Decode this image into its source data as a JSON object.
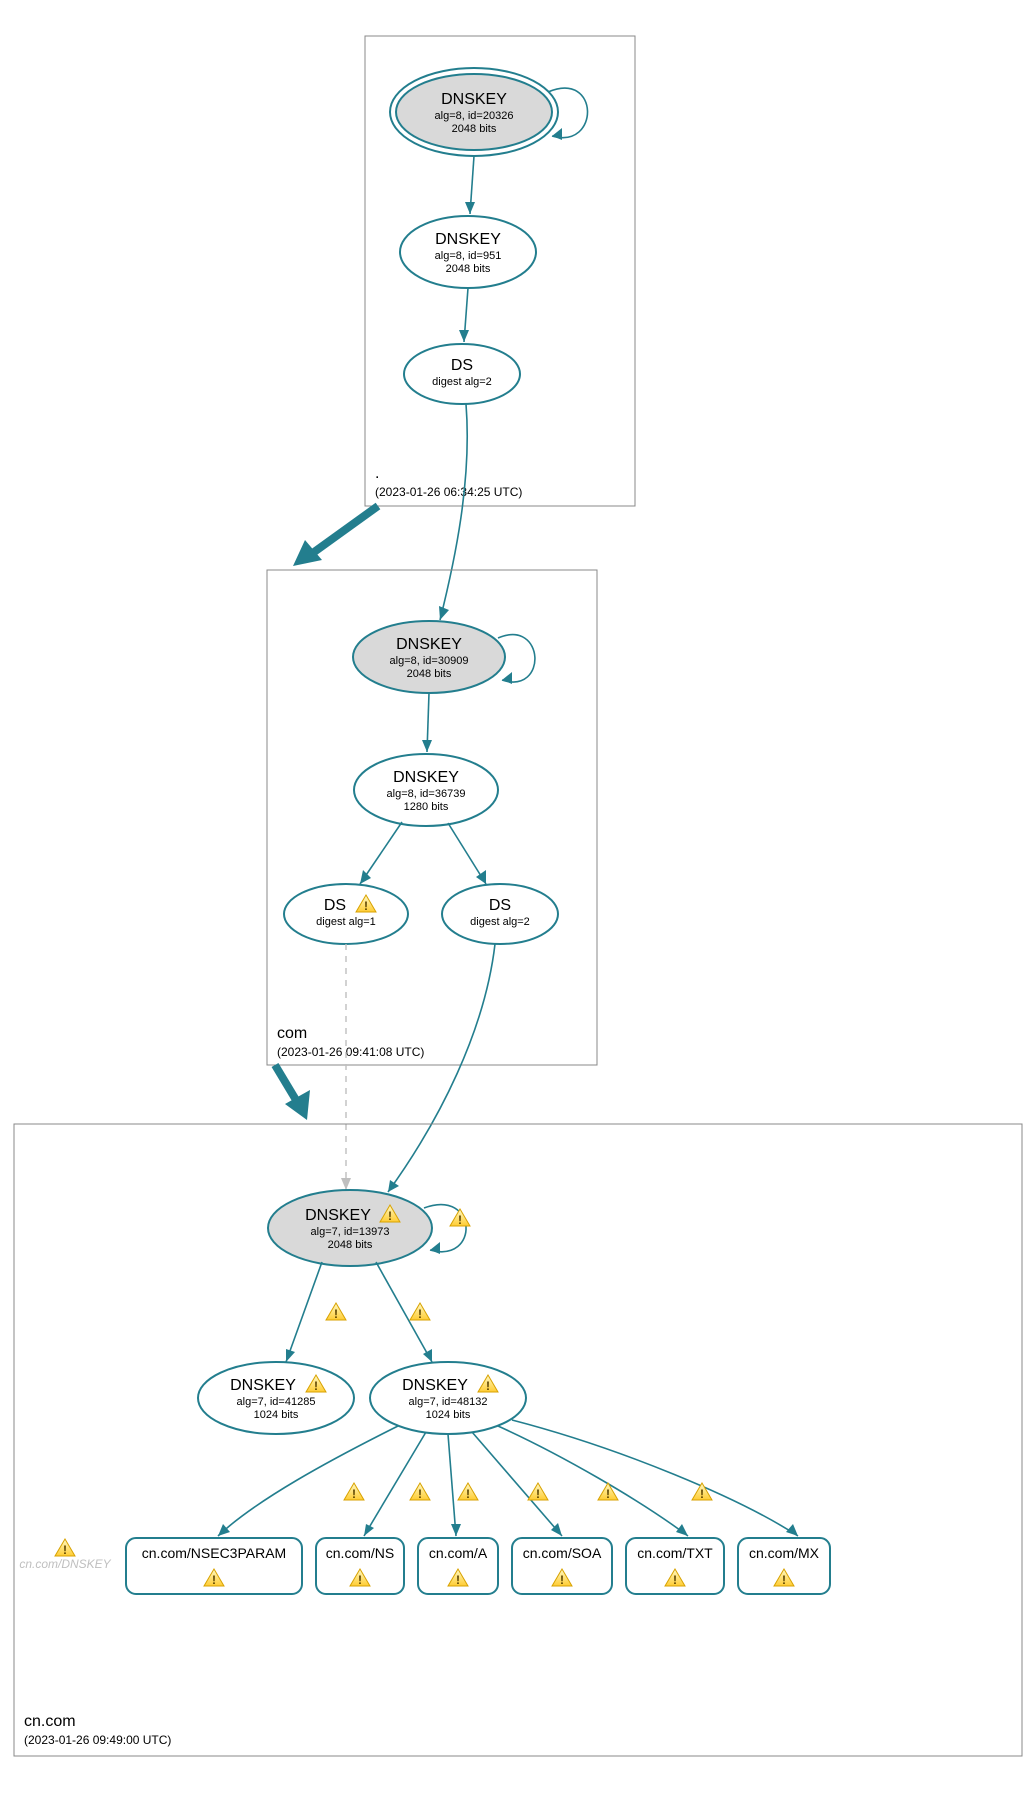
{
  "zones": {
    "root": {
      "name": ".",
      "timestamp": "(2023-01-26 06:34:25 UTC)",
      "nodes": {
        "ksk": {
          "title": "DNSKEY",
          "line1": "alg=8, id=20326",
          "line2": "2048 bits"
        },
        "zsk": {
          "title": "DNSKEY",
          "line1": "alg=8, id=951",
          "line2": "2048 bits"
        },
        "ds": {
          "title": "DS",
          "line1": "digest alg=2"
        }
      }
    },
    "com": {
      "name": "com",
      "timestamp": "(2023-01-26 09:41:08 UTC)",
      "nodes": {
        "ksk": {
          "title": "DNSKEY",
          "line1": "alg=8, id=30909",
          "line2": "2048 bits"
        },
        "zsk": {
          "title": "DNSKEY",
          "line1": "alg=8, id=36739",
          "line2": "1280 bits"
        },
        "ds1": {
          "title": "DS",
          "line1": "digest alg=1"
        },
        "ds2": {
          "title": "DS",
          "line1": "digest alg=2"
        }
      }
    },
    "cncom": {
      "name": "cn.com",
      "timestamp": "(2023-01-26 09:49:00 UTC)",
      "nodes": {
        "ksk": {
          "title": "DNSKEY",
          "line1": "alg=7, id=13973",
          "line2": "2048 bits"
        },
        "zsk1": {
          "title": "DNSKEY",
          "line1": "alg=7, id=41285",
          "line2": "1024 bits"
        },
        "zsk2": {
          "title": "DNSKEY",
          "line1": "alg=7, id=48132",
          "line2": "1024 bits"
        }
      },
      "records": {
        "nsec3param": "cn.com/NSEC3PARAM",
        "ns": "cn.com/NS",
        "a": "cn.com/A",
        "soa": "cn.com/SOA",
        "txt": "cn.com/TXT",
        "mx": "cn.com/MX"
      },
      "greyed": "cn.com/DNSKEY"
    }
  }
}
